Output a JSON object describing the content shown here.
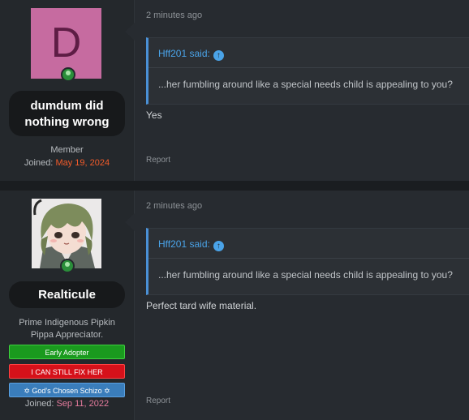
{
  "posts": [
    {
      "time": "2 minutes ago",
      "avatar_letter": "D",
      "username_line1": "dumdum did",
      "username_line2": "nothing wrong",
      "role": "Member",
      "joined_label": "Joined:",
      "joined_date": "May 19, 2024",
      "quote_author": "Hff201 said:",
      "quote_text": "...her fumbling around like a special needs child is appealing to you?",
      "message": "Yes",
      "report": "Report"
    },
    {
      "time": "2 minutes ago",
      "username": "Realticule",
      "title_line1": "Prime Indigenous Pipkin",
      "title_line2": "Pippa Appreciator.",
      "badges": [
        "Early Adopter",
        "I CAN STILL FIX HER",
        "✡ God's Chosen Schizo ✡"
      ],
      "joined_label": "Joined:",
      "joined_date": "Sep 11, 2022",
      "quote_author": "Hff201 said:",
      "quote_text": "...her fumbling around like a special needs child is appealing to you?",
      "message": "Perfect tard wife material.",
      "report": "Report"
    }
  ],
  "colors": {
    "background": "#1d2023",
    "quote_accent": "#4a90d6",
    "joined_date_1": "#f25b2a",
    "joined_date_2": "#e57b9d",
    "badge_green": "#1a9a1e",
    "badge_red": "#d6111a",
    "badge_blue": "#3a7dbb"
  }
}
